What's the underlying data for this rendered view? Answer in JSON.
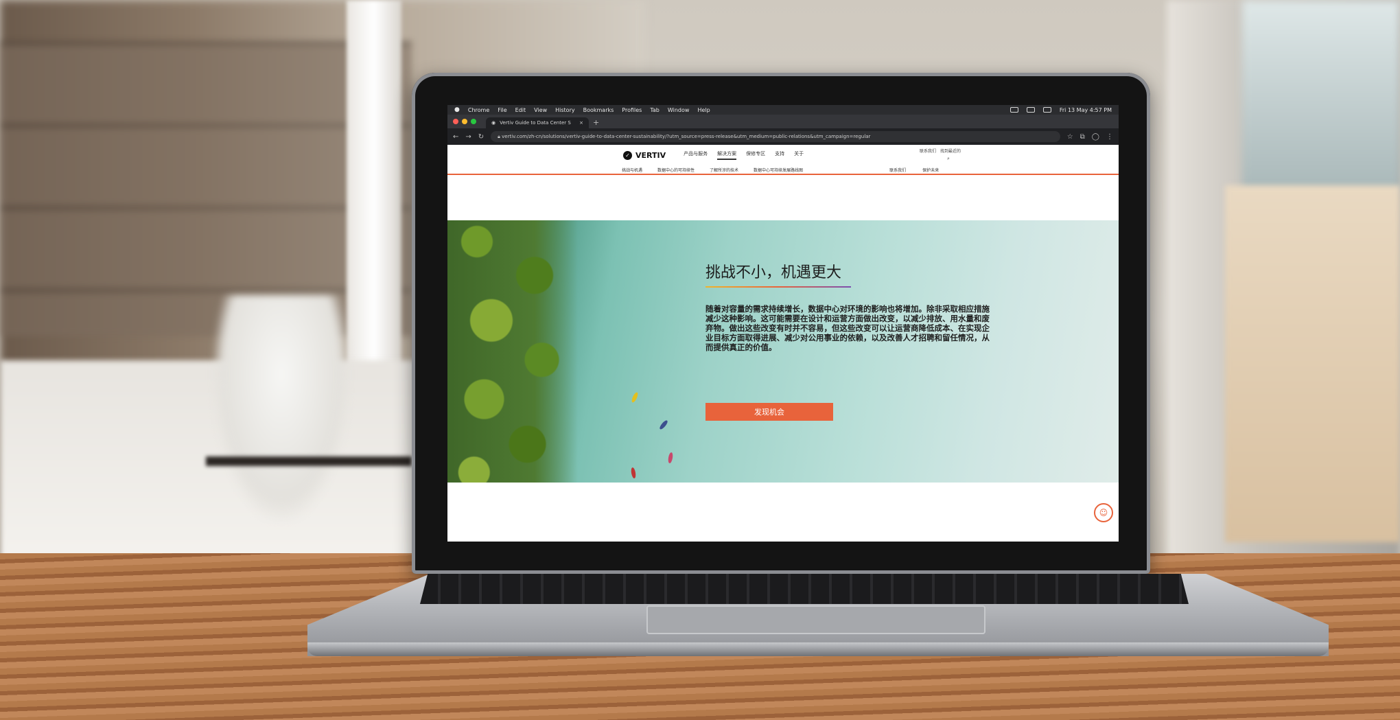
{
  "menubar": {
    "app": "Chrome",
    "items": [
      "File",
      "Edit",
      "View",
      "History",
      "Bookmarks",
      "Profiles",
      "Tab",
      "Window",
      "Help"
    ],
    "clock": "Fri 13 May 4:57 PM"
  },
  "browser": {
    "tab_title": "Vertiv Guide to Data Center S",
    "new_tab": "+",
    "url": "vertiv.com/zh-cn/solutions/vertiv-guide-to-data-center-sustainability/?utm_source=press-release&utm_medium=public-relations&utm_campaign=regular"
  },
  "site": {
    "logo_text": "VERTIV",
    "nav": [
      "产品与服务",
      "解决方案",
      "保修专区",
      "支持",
      "关于"
    ],
    "active_nav": "解决方案",
    "utility": [
      "联系我们",
      "找到最近的"
    ],
    "subnav_left": [
      "挑战与机遇",
      "数据中心的可持续性",
      "了解所涉的技术",
      "数据中心可持续发展路线图"
    ],
    "subnav_right": [
      "联系我们",
      "保护未来"
    ]
  },
  "hero": {
    "title": "挑战不小，机遇更大",
    "body": "随着对容量的需求持续增长，数据中心对环境的影响也将增加。除非采取相应措施减少这种影响。这可能需要在设计和运营方面做出改变，以减少排放、用水量和废弃物。做出这些改变有时并不容易，但这些改变可以让运营商降低成本、在实现企业目标方面取得进展、减少对公用事业的依赖，以及改善人才招聘和留任情况，从而提供真正的价值。",
    "cta": "发现机会"
  },
  "colors": {
    "accent": "#e8633b",
    "text": "#1d1d1d"
  },
  "icons": {
    "apple": "apple-icon",
    "search": "search-icon",
    "chat": "chat-icon"
  }
}
